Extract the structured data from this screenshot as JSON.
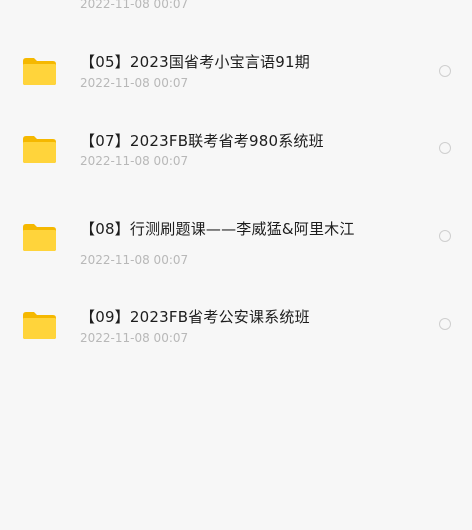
{
  "partial_item": {
    "date": "2022-11-08 00:07"
  },
  "items": [
    {
      "name": "【05】2023国省考小宝言语91期",
      "date": "2022-11-08 00:07",
      "icon": "folder-icon"
    },
    {
      "name": "【07】2023FB联考省考980系统班",
      "date": "2022-11-08 00:07",
      "icon": "folder-icon"
    },
    {
      "name": "【08】行测刷题课——李威猛&阿里木江",
      "date": "2022-11-08 00:07",
      "icon": "folder-icon"
    },
    {
      "name": "【09】2023FB省考公安课系统班",
      "date": "2022-11-08 00:07",
      "icon": "folder-icon"
    }
  ],
  "colors": {
    "folder_back": "#f5b800",
    "folder_front": "#ffd43b",
    "background": "#f7f7f7",
    "date_text": "#b8b8b8"
  }
}
